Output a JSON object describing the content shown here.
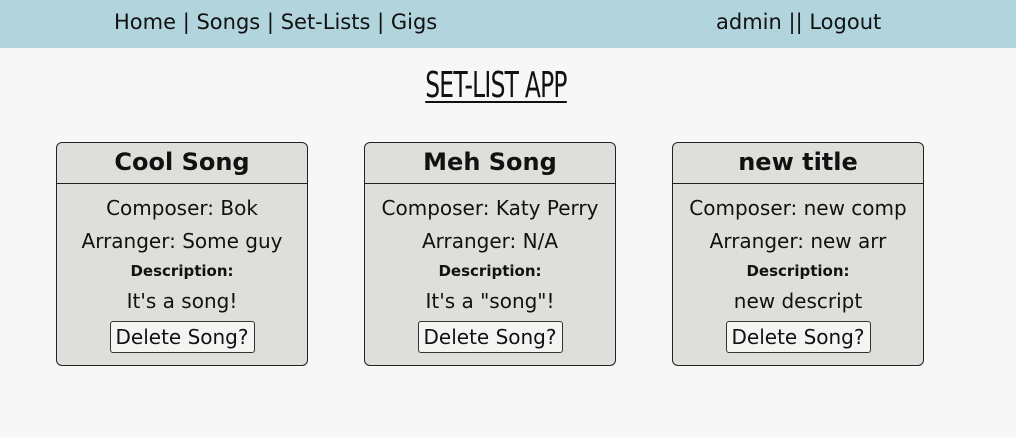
{
  "nav": {
    "home": "Home",
    "songs": "Songs",
    "setlists": "Set-Lists",
    "gigs": "Gigs",
    "separator": "|",
    "user": "admin",
    "user_separator": "||",
    "logout": "Logout"
  },
  "app_title": "SET-LIST APP",
  "songs": [
    {
      "title": "Cool Song",
      "composer": "Composer: Bok",
      "arranger": "Arranger: Some guy",
      "description_label": "Description:",
      "description": "It's a song!",
      "delete_label": "Delete Song?"
    },
    {
      "title": "Meh Song",
      "composer": "Composer: Katy Perry",
      "arranger": "Arranger: N/A",
      "description_label": "Description:",
      "description": "It's a \"song\"!",
      "delete_label": "Delete Song?"
    },
    {
      "title": "new title",
      "composer": "Composer: new comp",
      "arranger": "Arranger: new arr",
      "description_label": "Description:",
      "description": "new descript",
      "delete_label": "Delete Song?"
    }
  ],
  "colors": {
    "header_bg": "#b1d4dd",
    "page_bg": "#f7f7f7",
    "card_bg": "#dededa",
    "button_bg": "#f4f4f2"
  }
}
